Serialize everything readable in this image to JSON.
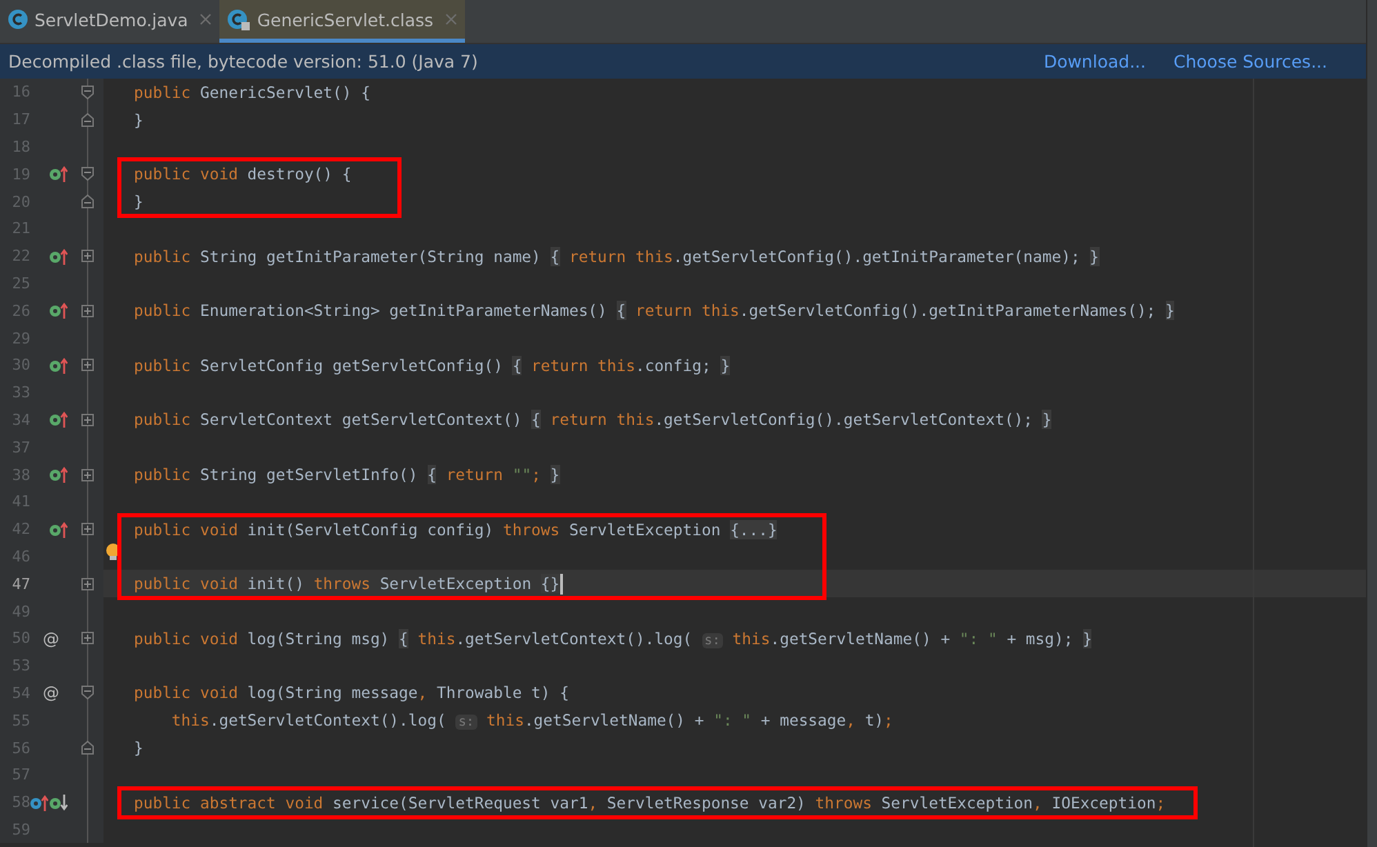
{
  "tabs": [
    {
      "label": "ServletDemo.java",
      "selected": false
    },
    {
      "label": "GenericServlet.class",
      "selected": true
    }
  ],
  "banner": {
    "message": "Decompiled .class file, bytecode version: 51.0 (Java 7)",
    "links": [
      "Download...",
      "Choose Sources..."
    ]
  },
  "editor": {
    "lines": [
      {
        "number": "16",
        "fold": {
          "kind": "open"
        },
        "marked": false,
        "current": false,
        "bulb": false,
        "tokens": [
          {
            "kind": "kw",
            "text": "public "
          },
          {
            "kind": "id",
            "text": "GenericServlet() {"
          }
        ]
      },
      {
        "number": "17",
        "fold": {
          "kind": "close"
        },
        "marked": false,
        "current": false,
        "bulb": false,
        "tokens": [
          {
            "kind": "id",
            "text": "}"
          }
        ]
      },
      {
        "number": "18",
        "marked": false,
        "current": false,
        "bulb": false
      },
      {
        "number": "19",
        "fold": {
          "kind": "open"
        },
        "gutter": [
          {
            "kind": "implements"
          }
        ],
        "marked": true,
        "current": false,
        "bulb": false,
        "tokens": [
          {
            "kind": "kw",
            "text": "public void "
          },
          {
            "kind": "id",
            "text": "destroy() {"
          }
        ]
      },
      {
        "number": "20",
        "fold": {
          "kind": "close"
        },
        "marked": true,
        "current": false,
        "bulb": false,
        "tokens": [
          {
            "kind": "id",
            "text": "}"
          }
        ]
      },
      {
        "number": "21",
        "marked": false,
        "current": false,
        "bulb": false
      },
      {
        "number": "22",
        "fold": {
          "kind": "collapsed"
        },
        "gutter": [
          {
            "kind": "implements"
          }
        ],
        "marked": false,
        "current": false,
        "bulb": false,
        "tokens": [
          {
            "kind": "kw",
            "text": "public "
          },
          {
            "kind": "id",
            "text": "String getInitParameter(String name) "
          },
          {
            "kind": "fold",
            "text": "{"
          },
          {
            "kind": "kw",
            "text": " return this"
          },
          {
            "kind": "id",
            "text": ".getServletConfig().getInitParameter(name); "
          },
          {
            "kind": "fold",
            "text": "}"
          }
        ]
      },
      {
        "number": "25",
        "marked": false,
        "current": false,
        "bulb": false
      },
      {
        "number": "26",
        "fold": {
          "kind": "collapsed"
        },
        "gutter": [
          {
            "kind": "implements"
          }
        ],
        "marked": false,
        "current": false,
        "bulb": false,
        "tokens": [
          {
            "kind": "kw",
            "text": "public "
          },
          {
            "kind": "id",
            "text": "Enumeration<String> getInitParameterNames() "
          },
          {
            "kind": "fold",
            "text": "{"
          },
          {
            "kind": "kw",
            "text": " return this"
          },
          {
            "kind": "id",
            "text": ".getServletConfig().getInitParameterNames(); "
          },
          {
            "kind": "fold",
            "text": "}"
          }
        ]
      },
      {
        "number": "29",
        "marked": false,
        "current": false,
        "bulb": false
      },
      {
        "number": "30",
        "fold": {
          "kind": "collapsed"
        },
        "gutter": [
          {
            "kind": "implements"
          }
        ],
        "marked": false,
        "current": false,
        "bulb": false,
        "tokens": [
          {
            "kind": "kw",
            "text": "public "
          },
          {
            "kind": "id",
            "text": "ServletConfig getServletConfig() "
          },
          {
            "kind": "fold",
            "text": "{"
          },
          {
            "kind": "kw",
            "text": " return this"
          },
          {
            "kind": "id",
            "text": ".config; "
          },
          {
            "kind": "fold",
            "text": "}"
          }
        ]
      },
      {
        "number": "33",
        "marked": false,
        "current": false,
        "bulb": false
      },
      {
        "number": "34",
        "fold": {
          "kind": "collapsed"
        },
        "gutter": [
          {
            "kind": "implements"
          }
        ],
        "marked": false,
        "current": false,
        "bulb": false,
        "tokens": [
          {
            "kind": "kw",
            "text": "public "
          },
          {
            "kind": "id",
            "text": "ServletContext getServletContext() "
          },
          {
            "kind": "fold",
            "text": "{"
          },
          {
            "kind": "kw",
            "text": " return this"
          },
          {
            "kind": "id",
            "text": ".getServletConfig().getServletContext(); "
          },
          {
            "kind": "fold",
            "text": "}"
          }
        ]
      },
      {
        "number": "37",
        "marked": false,
        "current": false,
        "bulb": false
      },
      {
        "number": "38",
        "fold": {
          "kind": "collapsed"
        },
        "gutter": [
          {
            "kind": "implements"
          }
        ],
        "marked": false,
        "current": false,
        "bulb": false,
        "tokens": [
          {
            "kind": "kw",
            "text": "public "
          },
          {
            "kind": "id",
            "text": "String getServletInfo() "
          },
          {
            "kind": "fold",
            "text": "{"
          },
          {
            "kind": "kw",
            "text": " return "
          },
          {
            "kind": "str",
            "text": "\"\""
          },
          {
            "kind": "kw",
            "text": "; "
          },
          {
            "kind": "fold",
            "text": "}"
          }
        ]
      },
      {
        "number": "41",
        "marked": false,
        "current": false,
        "bulb": false
      },
      {
        "number": "42",
        "fold": {
          "kind": "collapsed"
        },
        "gutter": [
          {
            "kind": "implements"
          }
        ],
        "marked": true,
        "current": false,
        "bulb": false,
        "tokens": [
          {
            "kind": "kw",
            "text": "public void "
          },
          {
            "kind": "id",
            "text": "init(ServletConfig config) "
          },
          {
            "kind": "kw",
            "text": "throws "
          },
          {
            "kind": "id",
            "text": "ServletException "
          },
          {
            "kind": "fold",
            "text": "{...}"
          }
        ]
      },
      {
        "number": "46",
        "marked": true,
        "current": false,
        "bulb": true
      },
      {
        "number": "47",
        "fold": {
          "kind": "collapsed"
        },
        "marked": true,
        "current": true,
        "bulb": false,
        "tokens": [
          {
            "kind": "kw",
            "text": "public void "
          },
          {
            "kind": "id",
            "text": "init() "
          },
          {
            "kind": "kw",
            "text": "throws "
          },
          {
            "kind": "id",
            "text": "ServletException "
          },
          {
            "kind": "fold",
            "text": "{}"
          }
        ]
      },
      {
        "number": "49",
        "marked": false,
        "current": false,
        "bulb": false
      },
      {
        "number": "50",
        "fold": {
          "kind": "collapsed"
        },
        "gutter": [
          {
            "kind": "annotation",
            "text": "@"
          }
        ],
        "marked": false,
        "current": false,
        "bulb": false,
        "tokens": [
          {
            "kind": "kw",
            "text": "public void "
          },
          {
            "kind": "id",
            "text": "log(String msg) "
          },
          {
            "kind": "fold",
            "text": "{"
          },
          {
            "kind": "kw",
            "text": " this"
          },
          {
            "kind": "id",
            "text": ".getServletContext().log( "
          },
          {
            "kind": "hint",
            "text": "s:"
          },
          {
            "kind": "kw",
            "text": " this"
          },
          {
            "kind": "id",
            "text": ".getServletName() + "
          },
          {
            "kind": "str",
            "text": "\": \""
          },
          {
            "kind": "id",
            "text": " + msg); "
          },
          {
            "kind": "fold",
            "text": "}"
          }
        ]
      },
      {
        "number": "53",
        "marked": false,
        "current": false,
        "bulb": false
      },
      {
        "number": "54",
        "fold": {
          "kind": "open"
        },
        "gutter": [
          {
            "kind": "annotation",
            "text": "@"
          }
        ],
        "marked": false,
        "current": false,
        "bulb": false,
        "tokens": [
          {
            "kind": "kw",
            "text": "public void "
          },
          {
            "kind": "id",
            "text": "log(String message"
          },
          {
            "kind": "kw",
            "text": ", "
          },
          {
            "kind": "id",
            "text": "Throwable t) {"
          }
        ]
      },
      {
        "number": "55",
        "marked": false,
        "current": false,
        "bulb": false,
        "tokens": [
          {
            "kind": "kw",
            "text": "    this"
          },
          {
            "kind": "id",
            "text": ".getServletContext().log( "
          },
          {
            "kind": "hint",
            "text": "s:"
          },
          {
            "kind": "kw",
            "text": " this"
          },
          {
            "kind": "id",
            "text": ".getServletName() + "
          },
          {
            "kind": "str",
            "text": "\": \""
          },
          {
            "kind": "id",
            "text": " + message"
          },
          {
            "kind": "kw",
            "text": ", "
          },
          {
            "kind": "id",
            "text": "t)"
          },
          {
            "kind": "kw",
            "text": ";"
          }
        ]
      },
      {
        "number": "56",
        "fold": {
          "kind": "close"
        },
        "marked": false,
        "current": false,
        "bulb": false,
        "tokens": [
          {
            "kind": "id",
            "text": "}"
          }
        ]
      },
      {
        "number": "57",
        "marked": false,
        "current": false,
        "bulb": false
      },
      {
        "number": "58",
        "gutter": [
          {
            "kind": "overrides"
          },
          {
            "kind": "implemented"
          }
        ],
        "marked": true,
        "current": false,
        "bulb": false,
        "tokens": [
          {
            "kind": "kw",
            "text": "public abstract void "
          },
          {
            "kind": "id",
            "text": "service(ServletRequest var1"
          },
          {
            "kind": "kw",
            "text": ", "
          },
          {
            "kind": "id",
            "text": "ServletResponse var2) "
          },
          {
            "kind": "kw",
            "text": "throws "
          },
          {
            "kind": "id",
            "text": "ServletException"
          },
          {
            "kind": "kw",
            "text": ", "
          },
          {
            "kind": "id",
            "text": "IOException"
          },
          {
            "kind": "kw",
            "text": ";"
          }
        ]
      },
      {
        "number": "59",
        "marked": false,
        "current": false,
        "bulb": false
      }
    ]
  }
}
